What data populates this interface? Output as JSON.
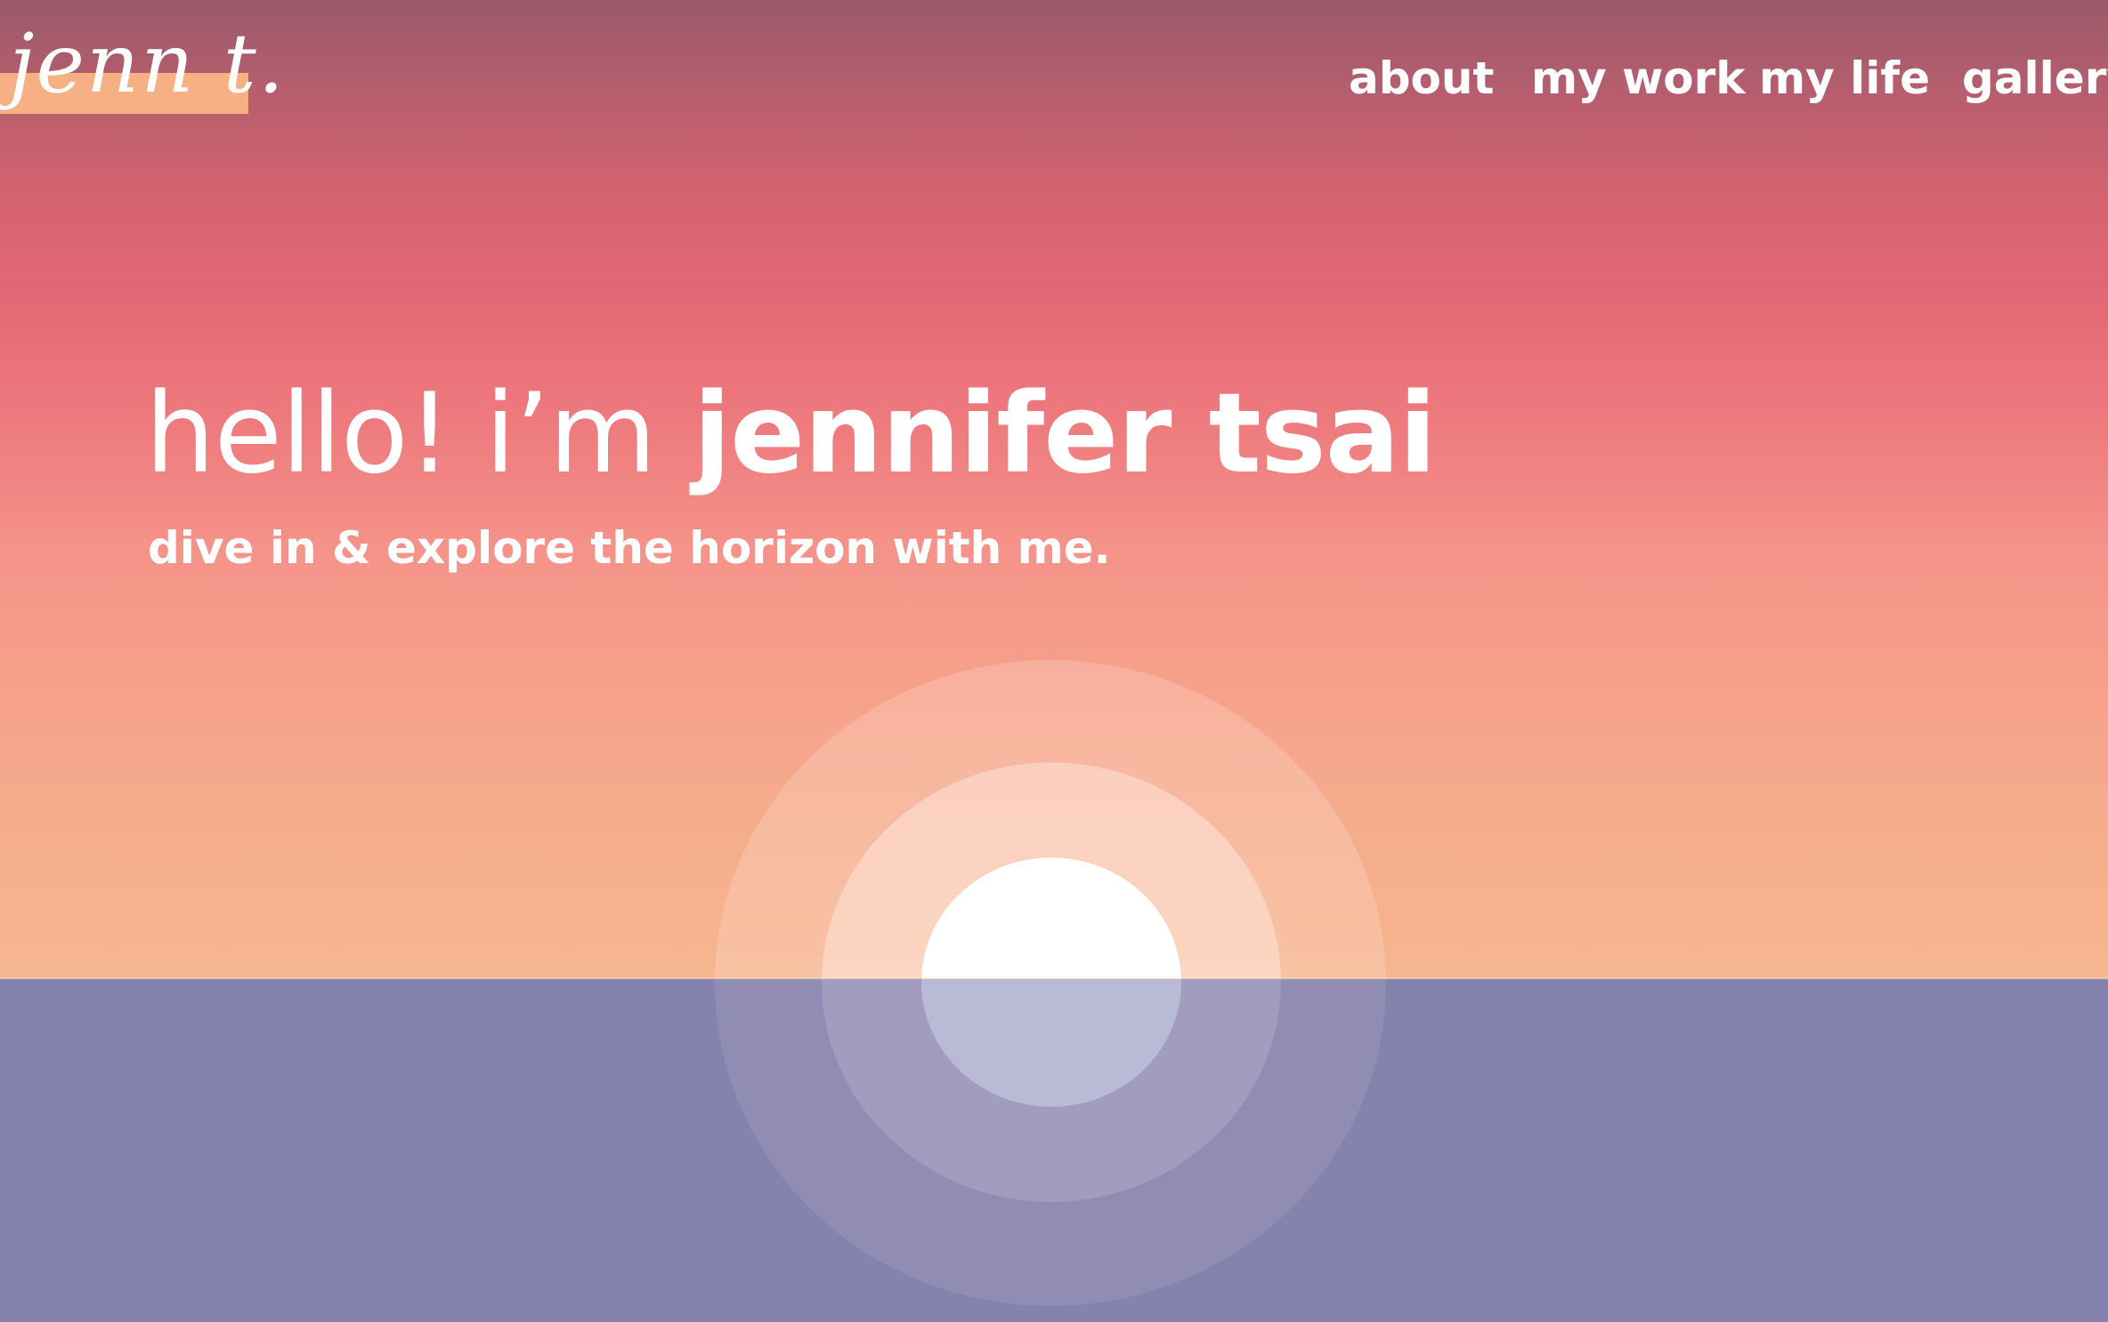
{
  "logo": {
    "text": "jenn t.",
    "accent_color": "#f6b083"
  },
  "nav": {
    "items": [
      {
        "label": "about"
      },
      {
        "label": "my work"
      },
      {
        "label": "my life"
      },
      {
        "label": "gallery"
      }
    ]
  },
  "hero": {
    "greeting": "hello! i’m",
    "name": "jennifer tsai",
    "tagline": "dive in & explore the horizon with me."
  },
  "colors": {
    "sky_top": "#9a5a6a",
    "sky_mid": "#e56876",
    "sky_bottom": "#f6b68f",
    "water": "#8e83a6",
    "sun": "#ffffff"
  }
}
